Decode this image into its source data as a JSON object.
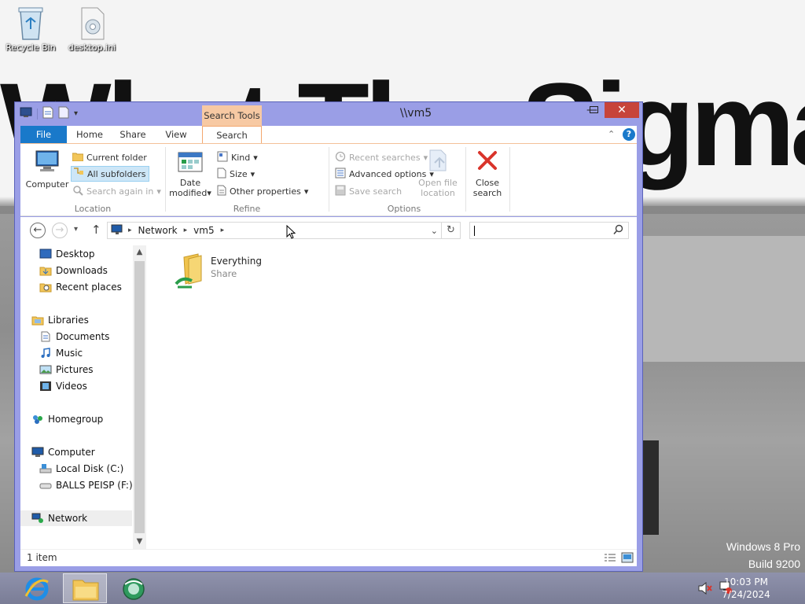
{
  "desktop": {
    "wallpaper_text": "What The Sigma?",
    "icons": [
      {
        "label": "Recycle Bin",
        "icon": "recycle-bin-icon"
      },
      {
        "label": "desktop.ini",
        "icon": "settings-file-icon"
      }
    ],
    "brand_line1": "Windows 8 Pro",
    "brand_line2": "Build 9200"
  },
  "window": {
    "title": "\\\\vm5",
    "context_tab": "Search Tools",
    "controls": {
      "minimize": "—",
      "maximize": "☐",
      "close": "✕"
    },
    "tabs": [
      "File",
      "Home",
      "Share",
      "View",
      "Search"
    ],
    "active_tab": "Search"
  },
  "ribbon": {
    "location": {
      "label": "Location",
      "computer": "Computer",
      "current_folder": "Current folder",
      "all_subfolders": "All subfolders",
      "search_again_in": "Search again in"
    },
    "refine": {
      "label": "Refine",
      "date_modified_line1": "Date",
      "date_modified_line2": "modified",
      "kind": "Kind",
      "size": "Size",
      "other_properties": "Other properties"
    },
    "options": {
      "label": "Options",
      "recent_searches": "Recent searches",
      "advanced_options": "Advanced options",
      "save_search": "Save search",
      "open_file_location_line1": "Open file",
      "open_file_location_line2": "location",
      "close_search_line1": "Close",
      "close_search_line2": "search"
    }
  },
  "address": {
    "crumbs": [
      "Network",
      "vm5"
    ],
    "search_placeholder": ""
  },
  "nav_pane": {
    "items": [
      {
        "label": "Desktop",
        "icon": "desktop-icon"
      },
      {
        "label": "Downloads",
        "icon": "downloads-folder-icon"
      },
      {
        "label": "Recent places",
        "icon": "recent-places-icon"
      },
      {
        "label": "Libraries",
        "icon": "libraries-icon"
      },
      {
        "label": "Documents",
        "icon": "documents-icon"
      },
      {
        "label": "Music",
        "icon": "music-icon"
      },
      {
        "label": "Pictures",
        "icon": "pictures-icon"
      },
      {
        "label": "Videos",
        "icon": "videos-icon"
      },
      {
        "label": "Homegroup",
        "icon": "homegroup-icon"
      },
      {
        "label": "Computer",
        "icon": "computer-icon"
      },
      {
        "label": "Local Disk (C:)",
        "icon": "local-disk-icon"
      },
      {
        "label": "BALLS PEISP (F:)",
        "icon": "removable-drive-icon"
      },
      {
        "label": "Network",
        "icon": "network-icon"
      }
    ]
  },
  "files": [
    {
      "name": "Everything",
      "type": "Share",
      "icon": "shared-folder-icon"
    }
  ],
  "status": {
    "item_count": "1 item"
  },
  "taskbar": {
    "apps": [
      {
        "name": "Internet Explorer",
        "icon": "internet-explorer-icon"
      },
      {
        "name": "File Explorer",
        "icon": "file-explorer-icon"
      },
      {
        "name": "Browser",
        "icon": "globe-icon"
      }
    ],
    "time": "10:03 PM",
    "date": "7/24/2024"
  }
}
